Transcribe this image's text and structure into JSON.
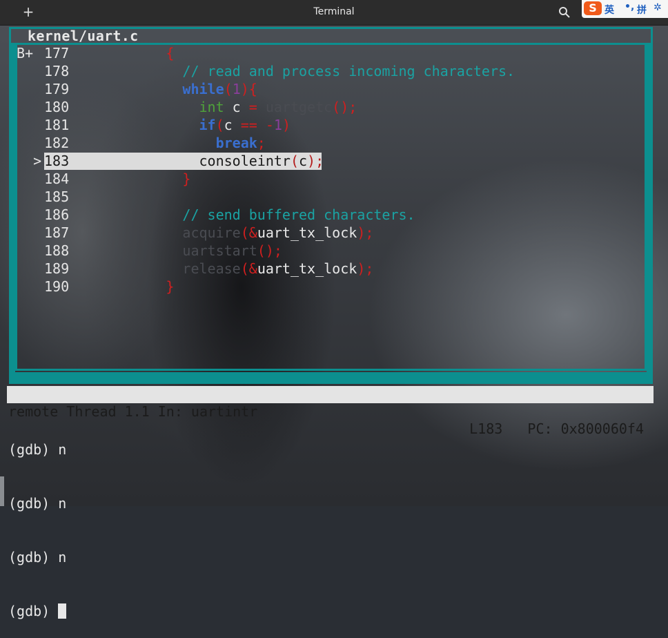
{
  "window": {
    "title": "Terminal",
    "new_tab_icon": "plus-icon",
    "search_icon": "search-icon"
  },
  "ime": {
    "logo": "S",
    "mode": "英",
    "punct": "•,",
    "pinyin": "拼",
    "settings_icon": "gear-icon"
  },
  "source": {
    "file": "kernel/uart.c",
    "breakpoint_marker": "B+",
    "pc_marker": ">",
    "lines": [
      {
        "num": "177",
        "indent": "        ",
        "tokens": [
          {
            "t": "{",
            "c": "punct"
          }
        ]
      },
      {
        "num": "178",
        "indent": "          ",
        "tokens": [
          {
            "t": "// read and process incoming characters.",
            "c": "comment"
          }
        ]
      },
      {
        "num": "179",
        "indent": "          ",
        "tokens": [
          {
            "t": "while",
            "c": "key"
          },
          {
            "t": "(",
            "c": "punct"
          },
          {
            "t": "1",
            "c": "num"
          },
          {
            "t": "){",
            "c": "punct"
          }
        ]
      },
      {
        "num": "180",
        "indent": "            ",
        "tokens": [
          {
            "t": "int",
            "c": "type"
          },
          {
            "t": " c ",
            "c": "id"
          },
          {
            "t": "=",
            "c": "punct"
          },
          {
            "t": " uartgetc",
            "c": "dim"
          },
          {
            "t": "();",
            "c": "punct"
          }
        ]
      },
      {
        "num": "181",
        "indent": "            ",
        "tokens": [
          {
            "t": "if",
            "c": "key"
          },
          {
            "t": "(",
            "c": "punct"
          },
          {
            "t": "c ",
            "c": "id"
          },
          {
            "t": "== -",
            "c": "punct"
          },
          {
            "t": "1",
            "c": "num"
          },
          {
            "t": ")",
            "c": "punct"
          }
        ]
      },
      {
        "num": "182",
        "indent": "              ",
        "tokens": [
          {
            "t": "break",
            "c": "key"
          },
          {
            "t": ";",
            "c": "punct"
          }
        ]
      },
      {
        "num": "183",
        "indent": "            ",
        "tokens": [
          {
            "t": "consoleintr",
            "c": "hl"
          },
          {
            "t": "(",
            "c": "hlp"
          },
          {
            "t": "c",
            "c": "hl"
          },
          {
            "t": ");",
            "c": "hlp"
          }
        ]
      },
      {
        "num": "184",
        "indent": "          ",
        "tokens": [
          {
            "t": "}",
            "c": "punct"
          }
        ]
      },
      {
        "num": "185",
        "indent": "",
        "tokens": []
      },
      {
        "num": "186",
        "indent": "          ",
        "tokens": [
          {
            "t": "// send buffered characters.",
            "c": "comment"
          }
        ]
      },
      {
        "num": "187",
        "indent": "          ",
        "tokens": [
          {
            "t": "acquire",
            "c": "dim"
          },
          {
            "t": "(&",
            "c": "punct"
          },
          {
            "t": "uart_tx_lock",
            "c": "id"
          },
          {
            "t": ");",
            "c": "punct"
          }
        ]
      },
      {
        "num": "188",
        "indent": "          ",
        "tokens": [
          {
            "t": "uartstart",
            "c": "dim"
          },
          {
            "t": "();",
            "c": "punct"
          }
        ]
      },
      {
        "num": "189",
        "indent": "          ",
        "tokens": [
          {
            "t": "release",
            "c": "dim"
          },
          {
            "t": "(&",
            "c": "punct"
          },
          {
            "t": "uart_tx_lock",
            "c": "id"
          },
          {
            "t": ");",
            "c": "punct"
          }
        ]
      },
      {
        "num": "190",
        "indent": "        ",
        "tokens": [
          {
            "t": "}",
            "c": "punct"
          }
        ]
      }
    ]
  },
  "status": {
    "left": "remote Thread 1.1 In: uartintr",
    "right": "L183   PC: 0x800060f4"
  },
  "console": {
    "lines": [
      "(gdb) n",
      "(gdb) n",
      "(gdb) n"
    ],
    "prompt": "(gdb) "
  },
  "colors": {
    "frame": "#0c8f8f",
    "comment": "#1aa3a3",
    "keyword": "#3a6fd0",
    "type": "#4fa33a",
    "punct": "#d11f1f"
  }
}
